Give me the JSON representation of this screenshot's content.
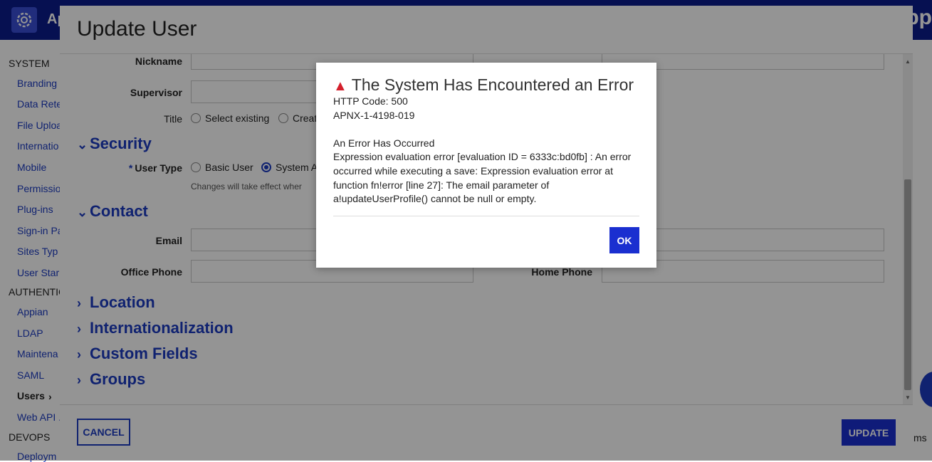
{
  "topbar": {
    "app_title": "Ap",
    "brand": "pp"
  },
  "sidebar": {
    "system": "SYSTEM",
    "items_system": [
      "Branding",
      "Data Rete",
      "File Uploa",
      "Internatio",
      "Mobile",
      "Permissio",
      "Plug-ins",
      "Sign-in Pa",
      "Sites Typ",
      "User Star"
    ],
    "authentication": "AUTHENTIC",
    "items_auth": [
      "Appian",
      "LDAP",
      "Maintena",
      "SAML",
      "Users",
      "Web API ."
    ],
    "devops": "DEVOPS",
    "items_devops": [
      "Deploym"
    ]
  },
  "right_bg": {
    "text": "ms"
  },
  "dialog": {
    "title": "Update User",
    "fields": {
      "nickname": "Nickname",
      "supervisor": "Supervisor",
      "title": "Title",
      "title_opt1": "Select existing",
      "title_opt2": "Creat",
      "user_type": "User Type",
      "user_type_opt1": "Basic User",
      "user_type_opt2": "System A",
      "user_type_hint": "Changes will take effect wher",
      "email": "Email",
      "office_phone": "Office Phone",
      "home_phone": "Home Phone"
    },
    "sections": {
      "security": "Security",
      "contact": "Contact",
      "location": "Location",
      "internationalization": "Internationalization",
      "custom_fields": "Custom Fields",
      "groups": "Groups"
    },
    "cancel": "CANCEL",
    "update": "UPDATE"
  },
  "error": {
    "title": "The System Has Encountered an Error",
    "http_code": "HTTP Code: 500",
    "error_id": "APNX-1-4198-019",
    "heading": "An Error Has Occurred",
    "message": "Expression evaluation error [evaluation ID = 6333c:bd0fb] : An error occurred while executing a save: Expression evaluation error at function fn!error [line 27]: The email parameter of a!updateUserProfile() cannot be null or empty.",
    "ok": "OK"
  },
  "colors": {
    "brand": "#0b1d8c",
    "accent": "#1a2fd0",
    "error": "#d4202c"
  }
}
